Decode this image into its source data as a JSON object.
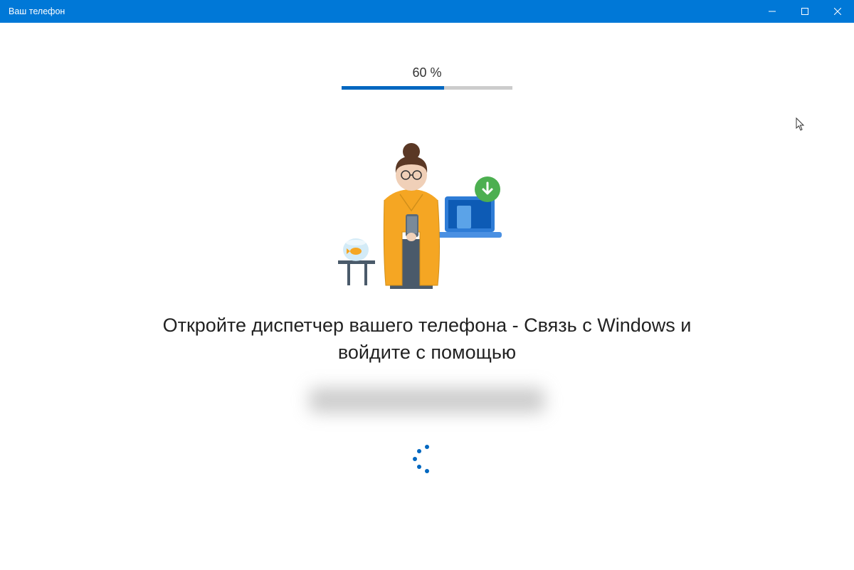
{
  "window": {
    "title": "Ваш телефон"
  },
  "progress": {
    "label": "60 %",
    "percent": 60
  },
  "main": {
    "heading": "Откройте диспетчер вашего телефона - Связь с Windows и войдите с помощью"
  },
  "colors": {
    "accent": "#0078d7",
    "progressFill": "#0067c0"
  }
}
